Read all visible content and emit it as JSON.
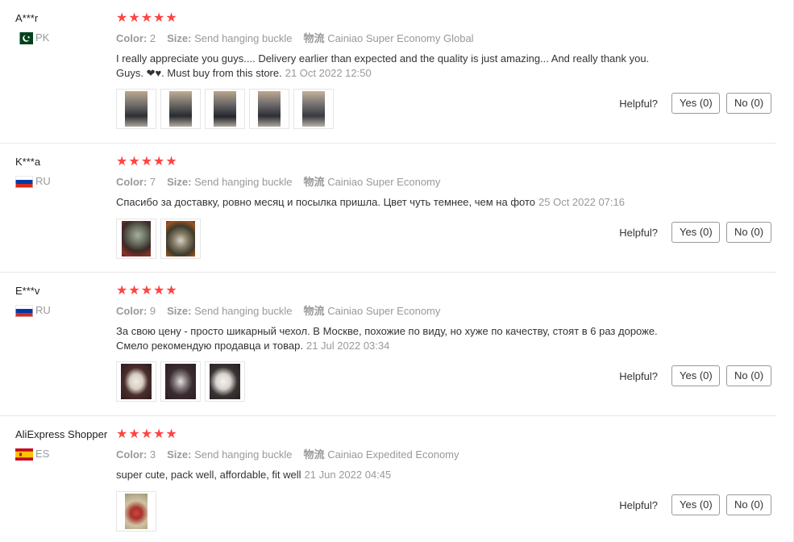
{
  "labels": {
    "color_key": "Color:",
    "size_key": "Size:",
    "ship_key": "物流",
    "helpful": "Helpful?",
    "stars": "★★★★★"
  },
  "colors": {
    "star": "#ff4747",
    "pk_flag_green": "#01411c",
    "ru_white": "#ffffff",
    "ru_blue": "#0039a6",
    "ru_red": "#d52b1e",
    "es_red": "#c60b1e",
    "es_yellow": "#ffc400"
  },
  "reviews": [
    {
      "user": "A***r",
      "country": "PK",
      "flag_icon": "pakistan-flag-icon",
      "rating": 5,
      "color": "2",
      "size": "Send hanging buckle",
      "shipping": "Cainiao Super Economy Global",
      "text_line1": "I really appreciate you guys.... Delivery earlier than expected and the quality is just amazing... And really thank you.",
      "text_line2": "Guys. ❤♥. Must buy from this store.",
      "date": "21 Oct 2022 12:50",
      "photos": 5,
      "yes": "Yes (0)",
      "no": "No (0)"
    },
    {
      "user": "K***a",
      "country": "RU",
      "flag_icon": "russia-flag-icon",
      "rating": 5,
      "color": "7",
      "size": "Send hanging buckle",
      "shipping": "Cainiao Super Economy",
      "text_line1": "Спасибо за доставку, ровно месяц и посылка пришла. Цвет чуть темнее, чем на фото",
      "text_line2": "",
      "date": "25 Oct 2022 07:16",
      "photos": 2,
      "yes": "Yes (0)",
      "no": "No (0)"
    },
    {
      "user": "E***v",
      "country": "RU",
      "flag_icon": "russia-flag-icon",
      "rating": 5,
      "color": "9",
      "size": "Send hanging buckle",
      "shipping": "Cainiao Super Economy",
      "text_line1": "За свою цену - просто шикарный чехол. В Москве, похожие по виду, но хуже по качеству, стоят в 6 раз дороже.",
      "text_line2": "Смело рекомендую продавца и товар.",
      "date": "21 Jul 2022 03:34",
      "photos": 3,
      "yes": "Yes (0)",
      "no": "No (0)"
    },
    {
      "user": "AliExpress Shopper",
      "country": "ES",
      "flag_icon": "spain-flag-icon",
      "rating": 5,
      "color": "3",
      "size": "Send hanging buckle",
      "shipping": "Cainiao Expedited Economy",
      "text_line1": "super cute, pack well, affordable, fit well",
      "text_line2": "",
      "date": "21 Jun 2022 04:45",
      "photos": 1,
      "yes": "Yes (0)",
      "no": "No (0)"
    }
  ]
}
